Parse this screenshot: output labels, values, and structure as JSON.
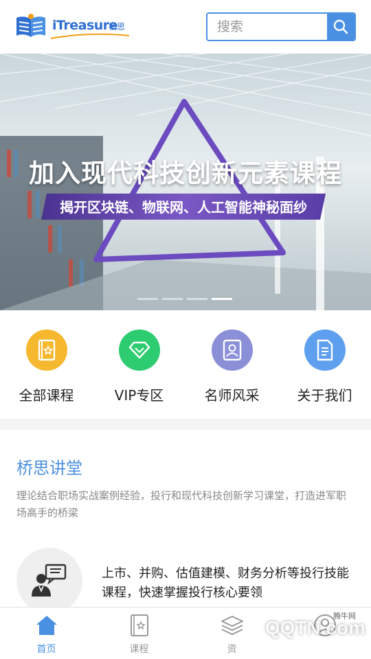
{
  "header": {
    "logo_text": "iTreasure",
    "logo_sub": "桥思",
    "search_placeholder": "搜索"
  },
  "banner": {
    "title": "加入现代科技创新元素课程",
    "subtitle": "揭开区块链、物联网、人工智能神秘面纱",
    "slide_count": 4,
    "active_slide": 4
  },
  "quick_nav": [
    {
      "label": "全部课程",
      "icon": "course-book-icon",
      "color": "#f5b82e"
    },
    {
      "label": "VIP专区",
      "icon": "diamond-icon",
      "color": "#2ecc71"
    },
    {
      "label": "名师风采",
      "icon": "teacher-portrait-icon",
      "color": "#8a8fd8"
    },
    {
      "label": "关于我们",
      "icon": "document-icon",
      "color": "#5ea0ef"
    }
  ],
  "section": {
    "title": "桥思讲堂",
    "description": "理论结合职场实战案例经验，投行和现代科技创新学习课堂，打造进军职场高手的桥梁",
    "feature_text": "上市、并购、估值建模、财务分析等投行技能课程，快速掌握投行核心要领"
  },
  "tabbar": [
    {
      "label": "首页",
      "icon": "home-icon",
      "active": true
    },
    {
      "label": "课程",
      "icon": "course-icon",
      "active": false
    },
    {
      "label": "资",
      "icon": "stack-icon",
      "active": false
    },
    {
      "label": "",
      "icon": "user-icon",
      "active": false
    }
  ],
  "watermark": {
    "text": "QQTN.com",
    "sub": "腾牛网"
  },
  "colors": {
    "accent": "#4a90e2"
  }
}
